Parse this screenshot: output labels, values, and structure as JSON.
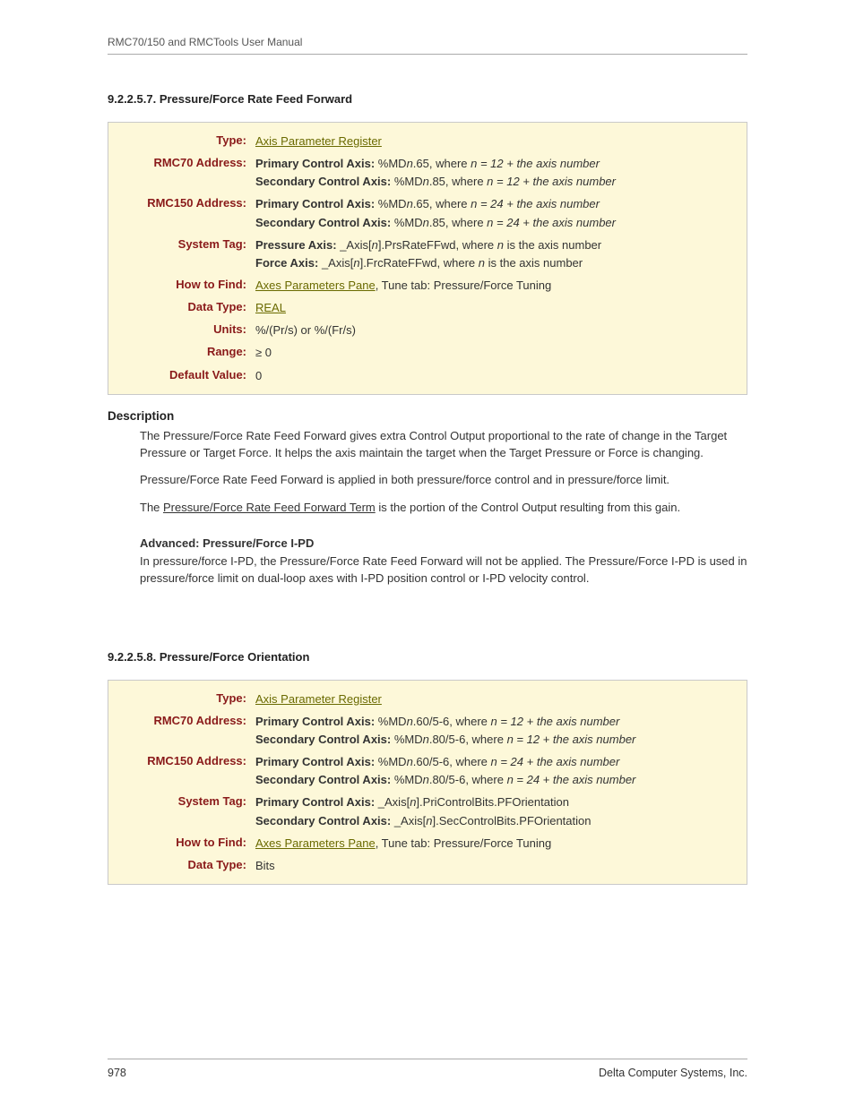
{
  "header": "RMC70/150 and RMCTools User Manual",
  "section1": {
    "heading": "9.2.2.5.7. Pressure/Force Rate Feed Forward",
    "rows": {
      "type_label": "Type:",
      "type_link": "Axis Parameter Register",
      "rmc70_label": "RMC70 Address:",
      "rmc70_primary_b": "Primary Control Axis:",
      "rmc70_primary_t": " %MD",
      "rmc70_primary_n": "n",
      "rmc70_primary_rest": ".65, where ",
      "rmc70_primary_eq": "n = 12 + the axis number",
      "rmc70_secondary_b": "Secondary Control Axis:",
      "rmc70_secondary_t": " %MD",
      "rmc70_secondary_n": "n",
      "rmc70_secondary_rest": ".85, where ",
      "rmc70_secondary_eq": "n = 12 + the axis number",
      "rmc150_label": "RMC150 Address:",
      "rmc150_primary_b": "Primary Control Axis:",
      "rmc150_primary_t": " %MD",
      "rmc150_primary_n": "n",
      "rmc150_primary_rest": ".65, where ",
      "rmc150_primary_eq": "n = 24 + the axis number",
      "rmc150_secondary_b": "Secondary Control Axis:",
      "rmc150_secondary_t": " %MD",
      "rmc150_secondary_n": "n",
      "rmc150_secondary_rest": ".85, where ",
      "rmc150_secondary_eq": "n = 24 + the axis number",
      "systag_label": "System Tag:",
      "systag_pressure_b": "Pressure Axis:",
      "systag_pressure_t1": " _Axis[",
      "systag_pressure_n1": "n",
      "systag_pressure_t2": "].PrsRateFFwd, where ",
      "systag_pressure_n2": "n",
      "systag_pressure_t3": " is the axis number",
      "systag_force_b": "Force Axis:",
      "systag_force_t1": " _Axis[",
      "systag_force_n1": "n",
      "systag_force_t2": "].FrcRateFFwd, where ",
      "systag_force_n2": "n",
      "systag_force_t3": " is the axis number",
      "howto_label": "How to Find:",
      "howto_link": "Axes Parameters Pane",
      "howto_rest": ", Tune tab: Pressure/Force Tuning",
      "datatype_label": "Data Type:",
      "datatype_link": "REAL",
      "units_label": "Units:",
      "units_val": "%/(Pr/s) or %/(Fr/s)",
      "range_label": "Range:",
      "range_val": "≥ 0",
      "default_label": "Default Value:",
      "default_val": "0"
    },
    "desc_head": "Description",
    "desc_p1": "The Pressure/Force Rate Feed Forward gives extra Control Output proportional to the rate of change in the Target Pressure or Target Force. It helps the axis maintain the target when the Target Pressure or Force is changing.",
    "desc_p2": "Pressure/Force Rate Feed Forward is applied in both pressure/force control and in pressure/force limit.",
    "desc_p3a": "The ",
    "desc_p3_link": "Pressure/Force Rate Feed Forward Term",
    "desc_p3b": " is the portion of the Control Output resulting from this gain.",
    "adv_head": "Advanced: Pressure/Force I-PD",
    "adv_p": "In pressure/force I-PD, the Pressure/Force Rate Feed Forward will not be applied. The Pressure/Force I-PD is used in pressure/force limit on dual-loop axes with I-PD position control or I-PD velocity control."
  },
  "section2": {
    "heading": "9.2.2.5.8. Pressure/Force Orientation",
    "rows": {
      "type_label": "Type:",
      "type_link": "Axis Parameter Register",
      "rmc70_label": "RMC70 Address:",
      "rmc70_primary_b": "Primary Control Axis:",
      "rmc70_primary_t": " %MD",
      "rmc70_primary_n": "n",
      "rmc70_primary_rest": ".60/5-6, where ",
      "rmc70_primary_eq": "n = 12 + the axis number",
      "rmc70_secondary_b": "Secondary Control Axis:",
      "rmc70_secondary_t": " %MD",
      "rmc70_secondary_n": "n",
      "rmc70_secondary_rest": ".80/5-6, where ",
      "rmc70_secondary_eq": "n = 12 + the axis number",
      "rmc150_label": "RMC150 Address:",
      "rmc150_primary_b": "Primary Control Axis:",
      "rmc150_primary_t": " %MD",
      "rmc150_primary_n": "n",
      "rmc150_primary_rest": ".60/5-6, where ",
      "rmc150_primary_eq": "n = 24 + the axis number",
      "rmc150_secondary_b": "Secondary Control Axis:",
      "rmc150_secondary_t": " %MD",
      "rmc150_secondary_n": "n",
      "rmc150_secondary_rest": ".80/5-6, where ",
      "rmc150_secondary_eq": "n = 24 + the axis number",
      "systag_label": "System Tag:",
      "systag_primary_b": "Primary Control Axis:",
      "systag_primary_t1": " _Axis[",
      "systag_primary_n1": "n",
      "systag_primary_t2": "].PriControlBits.PFOrientation",
      "systag_secondary_b": "Secondary Control Axis:",
      "systag_secondary_t1": " _Axis[",
      "systag_secondary_n1": "n",
      "systag_secondary_t2": "].SecControlBits.PFOrientation",
      "howto_label": "How to Find:",
      "howto_link": "Axes Parameters Pane",
      "howto_rest": ", Tune tab: Pressure/Force Tuning",
      "datatype_label": "Data Type:",
      "datatype_val": "Bits"
    }
  },
  "footer": {
    "page": "978",
    "company": "Delta Computer Systems, Inc."
  }
}
